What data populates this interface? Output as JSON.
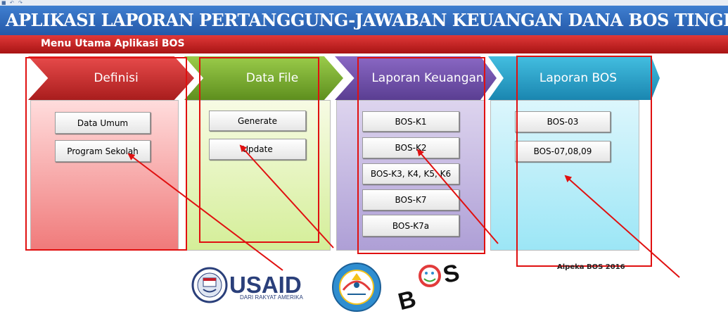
{
  "app": {
    "title": "APLIKASI LAPORAN PERTANGGUNG-JAWABAN  KEUANGAN DANA BOS TINGKAT SEKOLAH",
    "menu_title": "Menu Utama  Aplikasi  BOS",
    "footer_text": "Alpeka BOS 2016"
  },
  "sections": {
    "definisi": {
      "label": "Definisi",
      "buttons": [
        "Data Umum",
        "Program Sekolah"
      ]
    },
    "data_file": {
      "label": "Data File",
      "buttons": [
        "Generate",
        "Update"
      ]
    },
    "laporan_keuangan": {
      "label": "Laporan Keuangan",
      "buttons": [
        "BOS-K1",
        "BOS-K2",
        "BOS-K3, K4, K5, K6",
        "BOS-K7",
        "BOS-K7a"
      ]
    },
    "laporan_bos": {
      "label": "Laporan BOS",
      "buttons": [
        "BOS-03",
        "BOS-07,08,09"
      ]
    }
  },
  "logos": {
    "usaid": {
      "word": "USAID",
      "tagline": "DARI RAKYAT AMERIKA"
    },
    "bos": {
      "word": "BOS"
    }
  },
  "colors": {
    "title_bar": "#2f6cc0",
    "menu_bar": "#c81e1e",
    "definisi": "#c83232",
    "data_file": "#7aae32",
    "laporan_keuangan": "#6e4fab",
    "laporan_bos": "#2ea8d0",
    "annotation": "#e01010"
  }
}
